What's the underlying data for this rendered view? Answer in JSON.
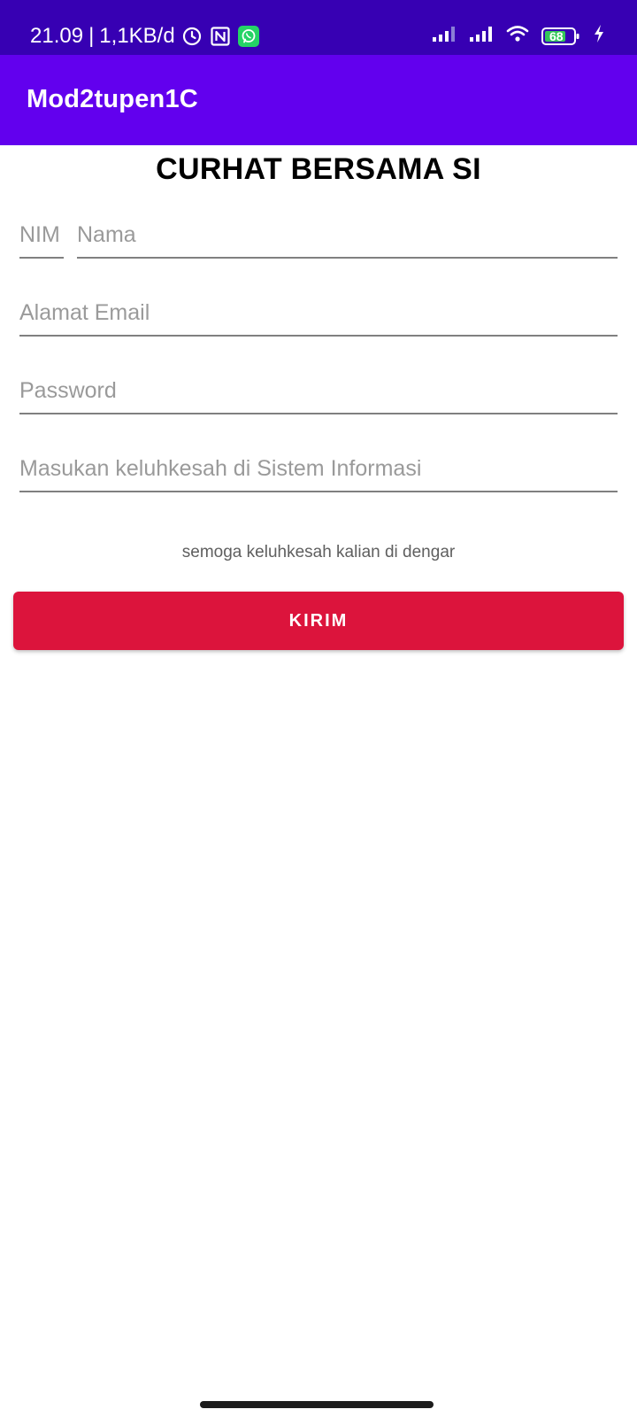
{
  "status_bar": {
    "time": "21.09",
    "separator": "|",
    "data_rate": "1,1KB/d",
    "icons": [
      "alarm-icon",
      "nfc-icon",
      "whatsapp-icon",
      "signal-icon",
      "signal-icon",
      "wifi-icon",
      "battery-icon",
      "charging-icon"
    ],
    "battery_level": "68"
  },
  "app_bar": {
    "title": "Mod2tupen1C"
  },
  "form": {
    "heading": "CURHAT BERSAMA SI",
    "nim_placeholder": "NIM",
    "nama_placeholder": "Nama",
    "email_placeholder": "Alamat Email",
    "password_placeholder": "Password",
    "complaint_placeholder": "Masukan keluhkesah di Sistem Informasi",
    "helper_text": "semoga keluhkesah kalian di dengar",
    "submit_label": "KIRIM"
  },
  "colors": {
    "status_bar": "#3700B3",
    "app_bar": "#6200EE",
    "button": "#DC143C"
  }
}
